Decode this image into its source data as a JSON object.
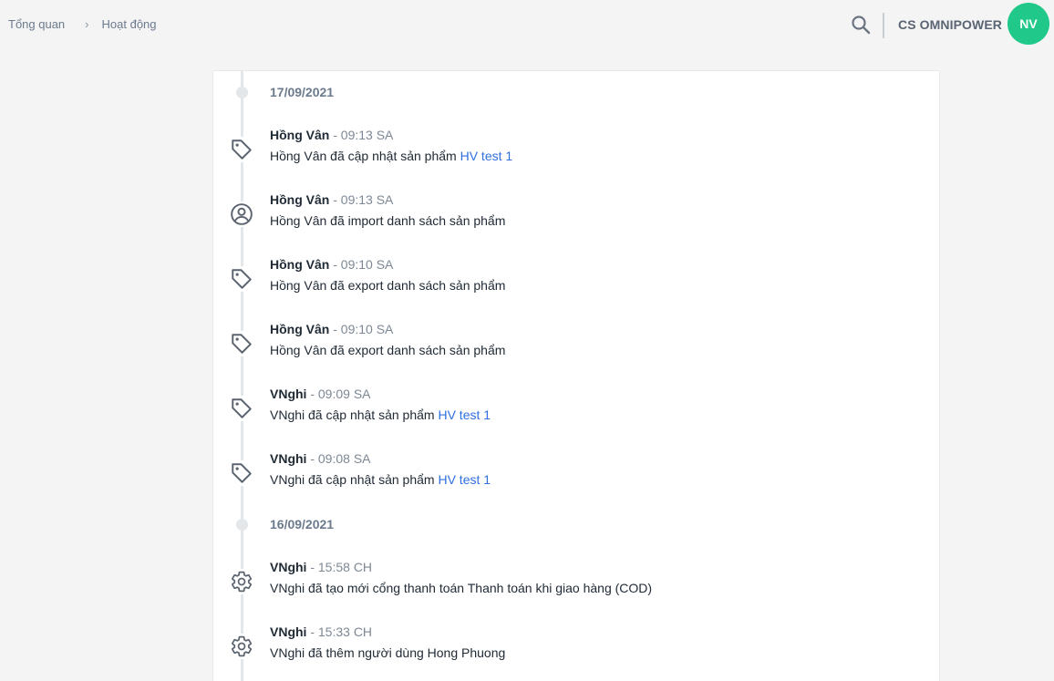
{
  "breadcrumb": {
    "home": "Tổng quan",
    "separator": "›",
    "current": "Hoạt động"
  },
  "header": {
    "store_name": "CS OMNIPOWER",
    "avatar_initials": "NV",
    "search_icon": "search-icon"
  },
  "colors": {
    "avatar_bg": "#20c98a",
    "link": "#2f6fe0",
    "timeline": "#e4e7ea"
  },
  "dates": [
    {
      "label": "17/09/2021"
    },
    {
      "label": "16/09/2021"
    }
  ],
  "activities": [
    {
      "icon": "tag-icon",
      "user": "Hồng Vân",
      "time": " - 09:13 SA",
      "desc": "Hồng Vân đã cập nhật sản phẩm ",
      "link": "HV test 1"
    },
    {
      "icon": "user-circle-icon",
      "user": "Hồng Vân",
      "time": " - 09:13 SA",
      "desc": "Hồng Vân đã import danh sách sản phẩm",
      "link": ""
    },
    {
      "icon": "tag-icon",
      "user": "Hồng Vân",
      "time": " - 09:10 SA",
      "desc": "Hồng Vân đã export danh sách sản phẩm",
      "link": ""
    },
    {
      "icon": "tag-icon",
      "user": "Hồng Vân",
      "time": " - 09:10 SA",
      "desc": "Hồng Vân đã export danh sách sản phẩm",
      "link": ""
    },
    {
      "icon": "tag-icon",
      "user": "VNghi",
      "time": " - 09:09 SA",
      "desc": "VNghi đã cập nhật sản phẩm ",
      "link": "HV test 1"
    },
    {
      "icon": "tag-icon",
      "user": "VNghi",
      "time": " - 09:08 SA",
      "desc": "VNghi đã cập nhật sản phẩm ",
      "link": "HV test 1"
    },
    {
      "icon": "gear-icon",
      "user": "VNghi",
      "time": " - 15:58 CH",
      "desc": "VNghi đã tạo mới cổng thanh toán Thanh toán khi giao hàng (COD)",
      "link": ""
    },
    {
      "icon": "gear-icon",
      "user": "VNghi",
      "time": " - 15:33 CH",
      "desc": "VNghi đã thêm người dùng Hong Phuong",
      "link": ""
    }
  ]
}
